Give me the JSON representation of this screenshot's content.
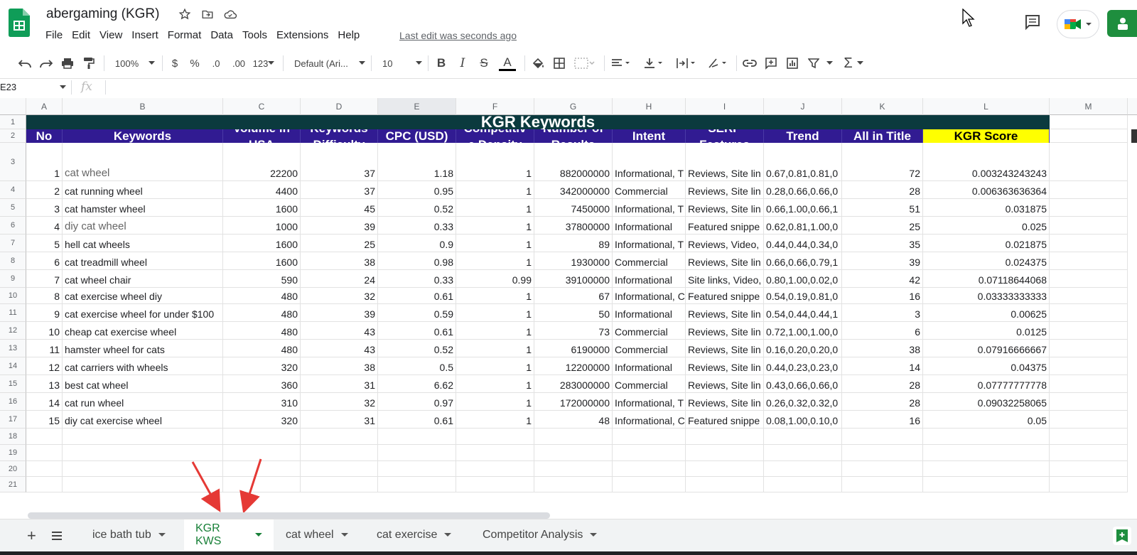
{
  "doc": {
    "title": "abergaming (KGR)",
    "last_edit": "Last edit was seconds ago"
  },
  "menu": [
    "File",
    "Edit",
    "View",
    "Insert",
    "Format",
    "Data",
    "Tools",
    "Extensions",
    "Help"
  ],
  "toolbar": {
    "zoom": "100%",
    "currency": "$",
    "percent": "%",
    "dec_decrease": ".0",
    "dec_increase": ".00",
    "more_formats": "123",
    "font": "Default (Ari...",
    "font_size": "10",
    "bold": "B",
    "italic": "I",
    "strike": "S",
    "text_color": "A",
    "sum": "Σ"
  },
  "formula": {
    "cell_ref": "E23",
    "fx": "fx"
  },
  "columns": [
    "A",
    "B",
    "C",
    "D",
    "E",
    "F",
    "G",
    "H",
    "I",
    "J",
    "K",
    "L",
    "M"
  ],
  "rows": [
    "1",
    "2",
    "3",
    "4",
    "5",
    "6",
    "7",
    "8",
    "9",
    "10",
    "11",
    "12",
    "13",
    "14",
    "15",
    "16",
    "17",
    "18",
    "19",
    "20",
    "21"
  ],
  "table": {
    "title": "KGR Keywords",
    "headers": [
      "No",
      "Keywords",
      "Volume in USA",
      "Keywords Difficulty",
      "CPC (USD)",
      "Competitive Density",
      "Number of Results",
      "Intent",
      "SERP Features",
      "Trend",
      "All in Title",
      "KGR Score"
    ],
    "headers_display": [
      "No",
      "Keywords",
      "Volume in\nUSA",
      "Keywords\nDifficulty",
      "CPC (USD)",
      "Competitiv\ne Density",
      "Number of\nResults",
      "Intent",
      "SERP\nFeatures",
      "Trend",
      "All in Title",
      "KGR Score"
    ],
    "data": [
      [
        "1",
        "cat wheel",
        "22200",
        "37",
        "1.18",
        "1",
        "882000000",
        "Informational, T",
        "Reviews, Site lin",
        "0.67,0.81,0.81,0",
        "72",
        "0.003243243243"
      ],
      [
        "2",
        "cat running wheel",
        "4400",
        "37",
        "0.95",
        "1",
        "342000000",
        "Commercial",
        "Reviews, Site lin",
        "0.28,0.66,0.66,0",
        "28",
        "0.006363636364"
      ],
      [
        "3",
        "cat hamster wheel",
        "1600",
        "45",
        "0.52",
        "1",
        "7450000",
        "Informational, T",
        "Reviews, Site lin",
        "0.66,1.00,0.66,1",
        "51",
        "0.031875"
      ],
      [
        "4",
        "diy cat wheel",
        "1000",
        "39",
        "0.33",
        "1",
        "37800000",
        "Informational",
        "Featured snippe",
        "0.62,0.81,1.00,0",
        "25",
        "0.025"
      ],
      [
        "5",
        "hell cat wheels",
        "1600",
        "25",
        "0.9",
        "1",
        "89",
        "Informational, T",
        "Reviews, Video, ",
        "0.44,0.44,0.34,0",
        "35",
        "0.021875"
      ],
      [
        "6",
        "cat treadmill wheel",
        "1600",
        "38",
        "0.98",
        "1",
        "1930000",
        "Commercial",
        "Reviews, Site lin",
        "0.66,0.66,0.79,1",
        "39",
        "0.024375"
      ],
      [
        "7",
        "cat wheel chair",
        "590",
        "24",
        "0.33",
        "0.99",
        "39100000",
        "Informational",
        "Site links, Video,",
        "0.80,1.00,0.02,0",
        "42",
        "0.07118644068"
      ],
      [
        "8",
        "cat exercise wheel diy",
        "480",
        "32",
        "0.61",
        "1",
        "67",
        "Informational, C",
        "Featured snippe",
        "0.54,0.19,0.81,0",
        "16",
        "0.03333333333"
      ],
      [
        "9",
        "cat exercise wheel for under $100",
        "480",
        "39",
        "0.59",
        "1",
        "50",
        "Informational",
        "Reviews, Site lin",
        "0.54,0.44,0.44,1",
        "3",
        "0.00625"
      ],
      [
        "10",
        "cheap cat exercise wheel",
        "480",
        "43",
        "0.61",
        "1",
        "73",
        "Commercial",
        "Reviews, Site lin",
        "0.72,1.00,1.00,0",
        "6",
        "0.0125"
      ],
      [
        "11",
        "hamster wheel for cats",
        "480",
        "43",
        "0.52",
        "1",
        "6190000",
        "Commercial",
        "Reviews, Site lin",
        "0.16,0.20,0.20,0",
        "38",
        "0.07916666667"
      ],
      [
        "12",
        "cat carriers with wheels",
        "320",
        "38",
        "0.5",
        "1",
        "12200000",
        "Informational",
        "Reviews, Site lin",
        "0.44,0.23,0.23,0",
        "14",
        "0.04375"
      ],
      [
        "13",
        "best cat wheel",
        "360",
        "31",
        "6.62",
        "1",
        "283000000",
        "Commercial",
        "Reviews, Site lin",
        "0.43,0.66,0.66,0",
        "28",
        "0.07777777778"
      ],
      [
        "14",
        "cat run wheel",
        "310",
        "32",
        "0.97",
        "1",
        "172000000",
        "Informational, T",
        "Reviews, Site lin",
        "0.26,0.32,0.32,0",
        "28",
        "0.09032258065"
      ],
      [
        "15",
        "diy cat exercise wheel",
        "320",
        "31",
        "0.61",
        "1",
        "48",
        "Informational, C",
        "Featured snippe",
        "0.08,1.00,0.10,0",
        "16",
        "0.05"
      ]
    ]
  },
  "sheets": [
    {
      "label": "ice bath tub",
      "active": false
    },
    {
      "label": "KGR KWS",
      "active": true
    },
    {
      "label": "cat wheel",
      "active": false
    },
    {
      "label": "cat exercise",
      "active": false
    },
    {
      "label": "Competitor Analysis",
      "active": false
    }
  ],
  "colors": {
    "title_bg": "#0b3a3e",
    "header_bg": "#311b92",
    "kgr_bg": "#ffff00",
    "active_tab": "#188038",
    "arrow": "#e53935"
  }
}
